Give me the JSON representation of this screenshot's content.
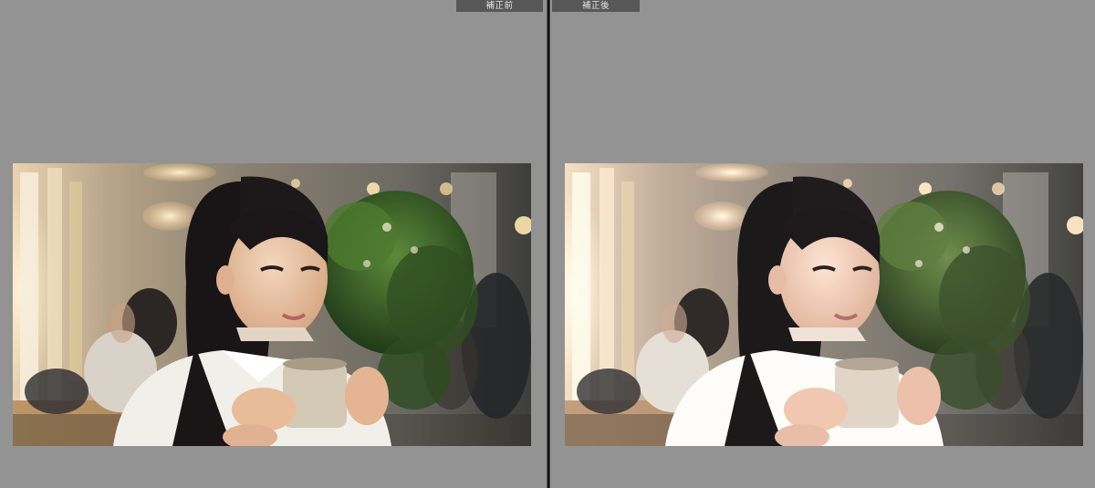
{
  "compare": {
    "before_label": "補正前",
    "after_label": "補正後"
  },
  "colors": {
    "workspace_bg": "#939393",
    "divider": "#111111",
    "label_bg": "#575757",
    "label_text": "#e2e2e2"
  }
}
